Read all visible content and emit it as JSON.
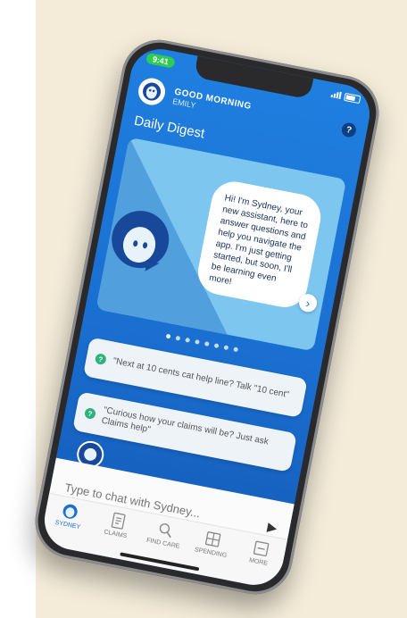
{
  "status_bar": {
    "time": "9:41"
  },
  "header": {
    "greeting": "GOOD MORNING",
    "user_name": "EMILY",
    "help_label": "?"
  },
  "digest": {
    "title": "Daily Digest",
    "bubble_text": "Hi! I'm Sydney, your new assistant, here to answer questions and help you navigate the app. I'm just getting started, but soon, I'll be learning even more!",
    "next_label": "›",
    "pager_total": 8,
    "pager_active": 0
  },
  "suggestions": [
    {
      "icon": "?",
      "text": "\"Next at 10 cents cat help line? Talk \"10 cent\""
    },
    {
      "icon": "?",
      "text": "\"Curious how your claims will be? Just ask Claims help\""
    }
  ],
  "chat": {
    "placeholder": "Type to chat with Sydney..."
  },
  "nav": [
    {
      "label": "SYDNEY",
      "icon": "sydney-avatar-icon",
      "active": true
    },
    {
      "label": "CLAIMS",
      "icon": "claims-document-icon",
      "active": false
    },
    {
      "label": "FIND CARE",
      "icon": "search-icon",
      "active": false
    },
    {
      "label": "SPENDING",
      "icon": "spending-icon",
      "active": false
    },
    {
      "label": "MORE",
      "icon": "more-icon",
      "active": false
    }
  ],
  "colors": {
    "primary": "#1a6fd0",
    "accent_green": "#2db37b",
    "mascot_navy": "#17489a"
  }
}
